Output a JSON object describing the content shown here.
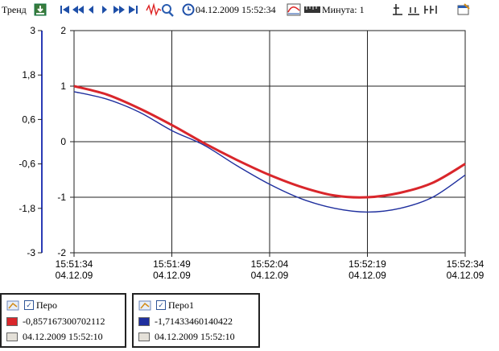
{
  "toolbar": {
    "trend_label": "Тренд",
    "datetime": "04.12.2009 15:52:34",
    "interval": "Минута: 1",
    "icons": [
      "export-icon",
      "first-icon",
      "fast-back-icon",
      "back-icon",
      "forward-icon",
      "fast-forward-icon",
      "last-icon",
      "signal-zoom-icon",
      "clock-icon",
      "curve-settings-icon",
      "ruler-icon",
      "cursor-icon",
      "align-bottom-icon",
      "align-columns-icon",
      "properties-icon"
    ]
  },
  "chart_data": {
    "type": "line",
    "x_ticks": [
      "15:51:34\n04.12.09",
      "15:51:49\n04.12.09",
      "15:52:04\n04.12.09",
      "15:52:19\n04.12.09",
      "15:52:34\n04.12.09"
    ],
    "x_tick_time": [
      "15:51:34",
      "15:51:49",
      "15:52:04",
      "15:52:19",
      "15:52:34"
    ],
    "x_tick_date": [
      "04.12.09",
      "04.12.09",
      "04.12.09",
      "04.12.09",
      "04.12.09"
    ],
    "x_range_seconds": [
      0,
      60
    ],
    "left_axis": {
      "ticks": [
        "3",
        "1,8",
        "0,6",
        "-0,6",
        "-1,8",
        "-3"
      ],
      "ylim": [
        -3,
        3
      ],
      "color": "#2a3bb5"
    },
    "right_axis": {
      "ticks": [
        "2",
        "1",
        "0",
        "-1",
        "-2"
      ],
      "ylim": [
        -2,
        2
      ]
    },
    "grid": true,
    "series": [
      {
        "name": "Перо",
        "color": "#d9262b",
        "axis": "right",
        "x": [
          0,
          5,
          10,
          15,
          20,
          25,
          30,
          35,
          40,
          45,
          50,
          55,
          60
        ],
        "y": [
          1.0,
          0.85,
          0.6,
          0.3,
          -0.03,
          -0.33,
          -0.6,
          -0.82,
          -0.97,
          -1.0,
          -0.92,
          -0.74,
          -0.4
        ]
      },
      {
        "name": "Перо1",
        "color": "#1f2f9e",
        "axis": "left",
        "x": [
          0,
          5,
          10,
          15,
          20,
          25,
          30,
          35,
          40,
          45,
          50,
          55,
          60
        ],
        "y": [
          1.35,
          1.15,
          0.8,
          0.3,
          -0.1,
          -0.65,
          -1.15,
          -1.55,
          -1.8,
          -1.9,
          -1.8,
          -1.5,
          -0.9
        ]
      }
    ]
  },
  "legend": [
    {
      "name": "Перо",
      "value": "-0,857167300702112",
      "time": "04.12.2009 15:52:10",
      "color": "#d9262b"
    },
    {
      "name": "Перо1",
      "value": "-1,71433460140422",
      "time": "04.12.2009 15:52:10",
      "color": "#1f2f9e"
    }
  ]
}
